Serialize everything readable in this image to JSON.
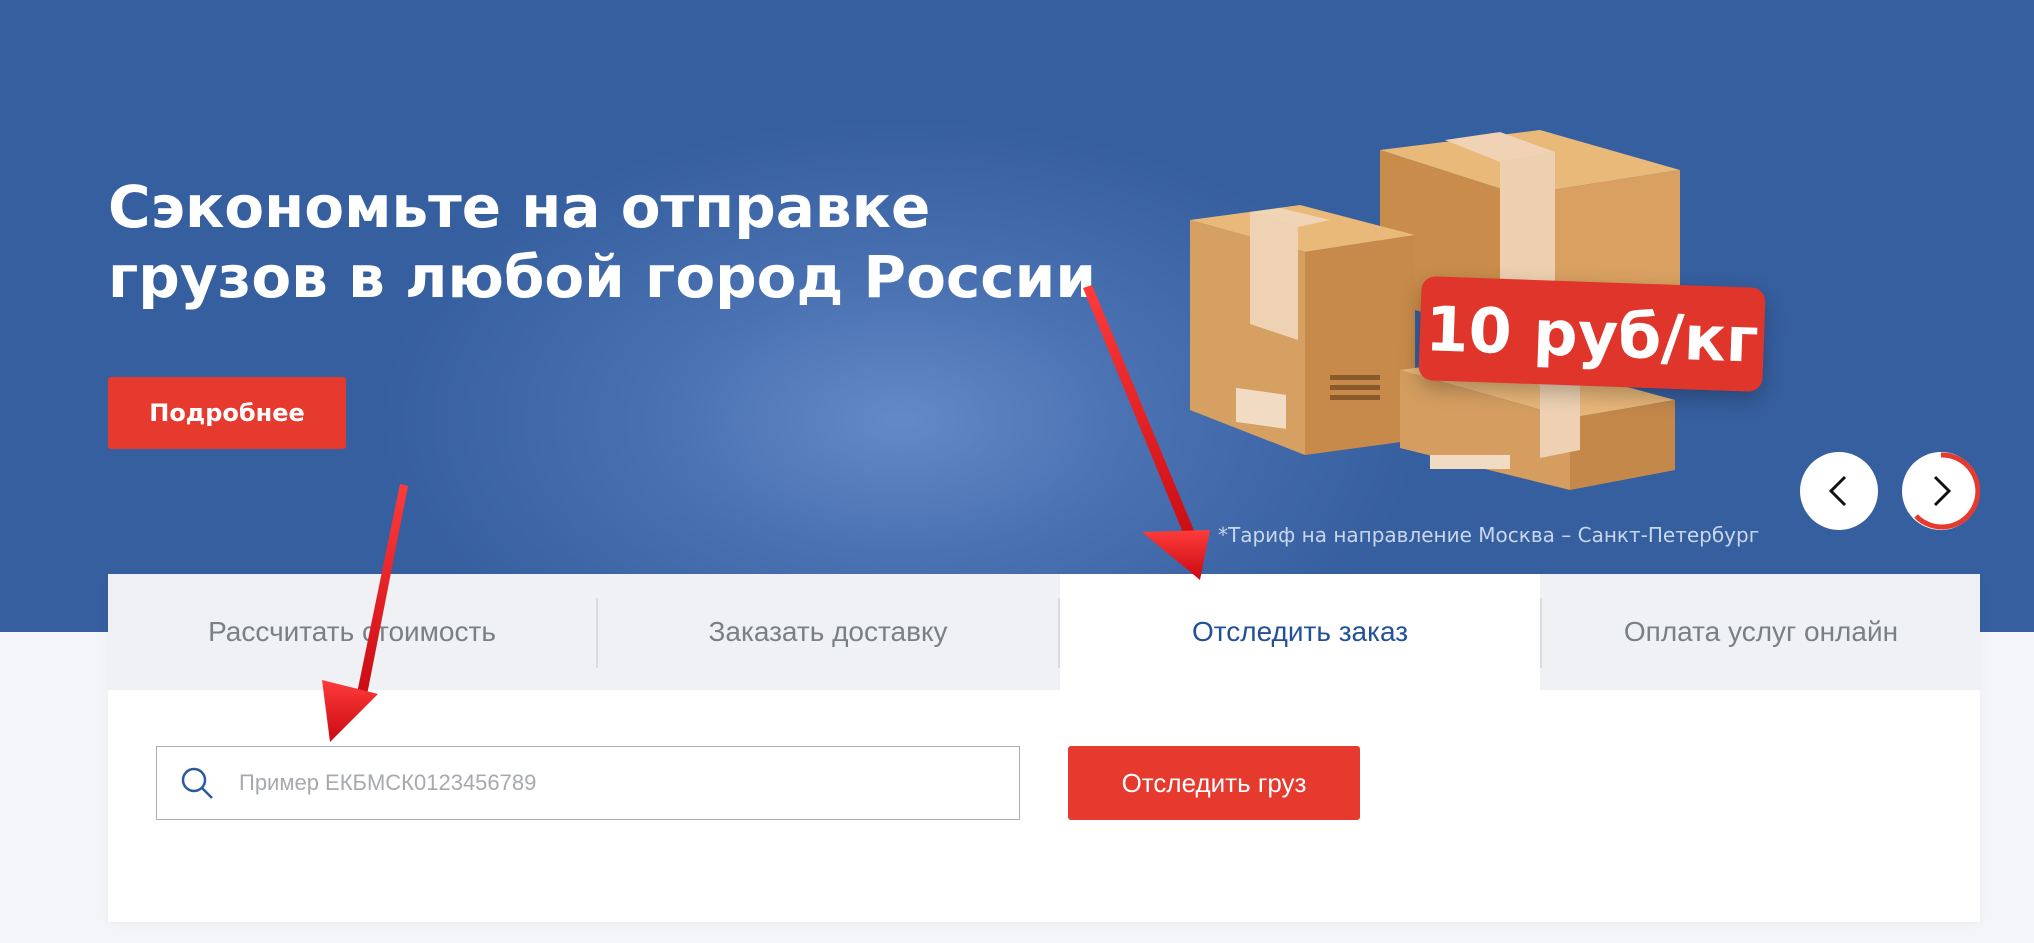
{
  "hero": {
    "title": "Сэкономьте на отправке грузов в любой город России",
    "more_button": "Подробнее",
    "price_badge": "10 руб/кг",
    "tariff_note": "*Тариф на направление Москва – Санкт-Петербург"
  },
  "slider": {
    "prev_icon": "chevron-left-icon",
    "next_icon": "chevron-right-icon"
  },
  "tabs": [
    {
      "label": "Рассчитать стоимость"
    },
    {
      "label": "Заказать доставку"
    },
    {
      "label": "Отследить заказ"
    },
    {
      "label": "Оплата услуг онлайн"
    }
  ],
  "tracking": {
    "search_icon": "search-icon",
    "placeholder": "Пример ЕКБМСК0123456789",
    "value": "",
    "button": "Отследить груз"
  },
  "colors": {
    "hero_blue": "#4a72b2",
    "accent_red": "#e63a2e",
    "active_tab_text": "#22519a",
    "annotation_arrow": "#e0131b"
  }
}
